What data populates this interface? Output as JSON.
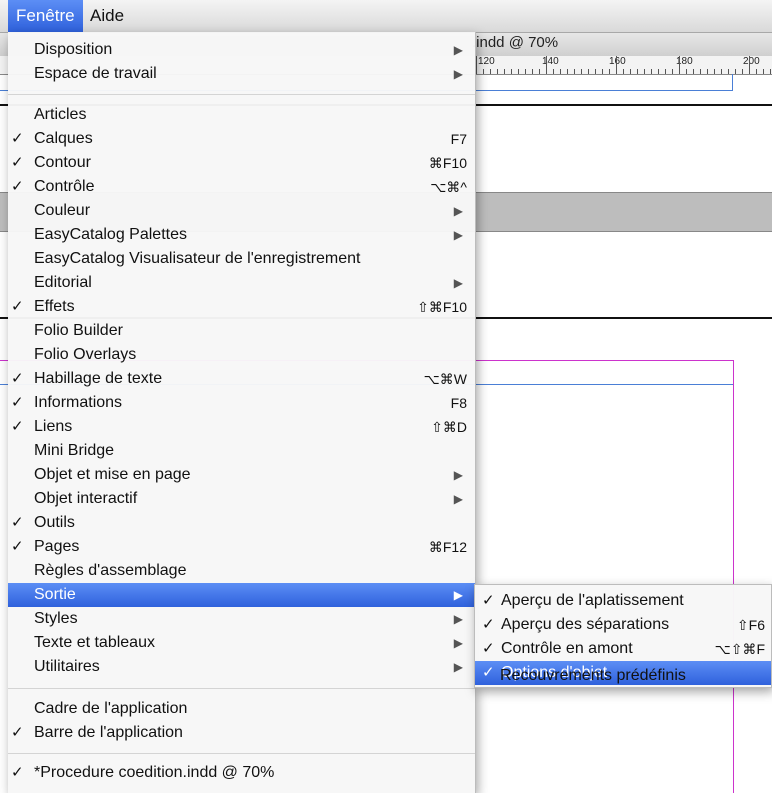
{
  "menubar": {
    "items": [
      "Fenêtre",
      "Aide"
    ]
  },
  "document": {
    "tab_title": ".indd @ 70%",
    "ruler_labels": [
      "120",
      "140",
      "160",
      "180",
      "200"
    ]
  },
  "menu": {
    "items": [
      {
        "label": "Disposition",
        "check": "",
        "shortcut": "",
        "arrow": "▶"
      },
      {
        "label": "Espace de travail",
        "check": "",
        "shortcut": "",
        "arrow": "▶"
      },
      {
        "label": "Articles",
        "check": "",
        "shortcut": "",
        "arrow": ""
      },
      {
        "label": "Calques",
        "check": "✓",
        "shortcut": "F7",
        "arrow": ""
      },
      {
        "label": "Contour",
        "check": "✓",
        "shortcut": "⌘F10",
        "arrow": ""
      },
      {
        "label": "Contrôle",
        "check": "✓",
        "shortcut": "⌥⌘^",
        "arrow": ""
      },
      {
        "label": "Couleur",
        "check": "",
        "shortcut": "",
        "arrow": "▶"
      },
      {
        "label": "EasyCatalog Palettes",
        "check": "",
        "shortcut": "",
        "arrow": "▶"
      },
      {
        "label": "EasyCatalog Visualisateur de l'enregistrement",
        "check": "",
        "shortcut": "",
        "arrow": ""
      },
      {
        "label": "Editorial",
        "check": "",
        "shortcut": "",
        "arrow": "▶"
      },
      {
        "label": "Effets",
        "check": "✓",
        "shortcut": "⇧⌘F10",
        "arrow": ""
      },
      {
        "label": "Folio Builder",
        "check": "",
        "shortcut": "",
        "arrow": ""
      },
      {
        "label": "Folio Overlays",
        "check": "",
        "shortcut": "",
        "arrow": ""
      },
      {
        "label": "Habillage de texte",
        "check": "✓",
        "shortcut": "⌥⌘W",
        "arrow": ""
      },
      {
        "label": "Informations",
        "check": "✓",
        "shortcut": "F8",
        "arrow": ""
      },
      {
        "label": "Liens",
        "check": "✓",
        "shortcut": "⇧⌘D",
        "arrow": ""
      },
      {
        "label": "Mini Bridge",
        "check": "",
        "shortcut": "",
        "arrow": ""
      },
      {
        "label": "Objet et mise en page",
        "check": "",
        "shortcut": "",
        "arrow": "▶"
      },
      {
        "label": "Objet interactif",
        "check": "",
        "shortcut": "",
        "arrow": "▶"
      },
      {
        "label": "Outils",
        "check": "✓",
        "shortcut": "",
        "arrow": ""
      },
      {
        "label": "Pages",
        "check": "✓",
        "shortcut": "⌘F12",
        "arrow": ""
      },
      {
        "label": "Règles d'assemblage",
        "check": "",
        "shortcut": "",
        "arrow": ""
      },
      {
        "label": "Sortie",
        "check": "",
        "shortcut": "",
        "arrow": "▶",
        "highlighted": true
      },
      {
        "label": "Styles",
        "check": "",
        "shortcut": "",
        "arrow": "▶"
      },
      {
        "label": "Texte et tableaux",
        "check": "",
        "shortcut": "",
        "arrow": "▶"
      },
      {
        "label": "Utilitaires",
        "check": "",
        "shortcut": "",
        "arrow": "▶"
      },
      {
        "label": "Cadre de l'application",
        "check": "",
        "shortcut": "",
        "arrow": ""
      },
      {
        "label": "Barre de l'application",
        "check": "✓",
        "shortcut": "",
        "arrow": ""
      },
      {
        "label": "*Procedure coedition.indd @ 70%",
        "check": "✓",
        "shortcut": "",
        "arrow": ""
      }
    ]
  },
  "submenu": {
    "items": [
      {
        "label": "Aperçu de l'aplatissement",
        "check": "✓",
        "shortcut": ""
      },
      {
        "label": "Aperçu des séparations",
        "check": "✓",
        "shortcut": "⇧F6"
      },
      {
        "label": "Contrôle en amont",
        "check": "✓",
        "shortcut": "⌥⇧⌘F"
      },
      {
        "label": "Options d'objet",
        "check": "✓",
        "shortcut": "",
        "highlighted": true
      },
      {
        "label": "Recouvrements prédéfinis",
        "check": "",
        "shortcut": ""
      }
    ]
  },
  "colors": {
    "highlight": "#3b6fe0",
    "menu_bg": "#f7f7f7",
    "frame_blue": "#4a7fd6",
    "margin_magenta": "#cc33cc"
  }
}
